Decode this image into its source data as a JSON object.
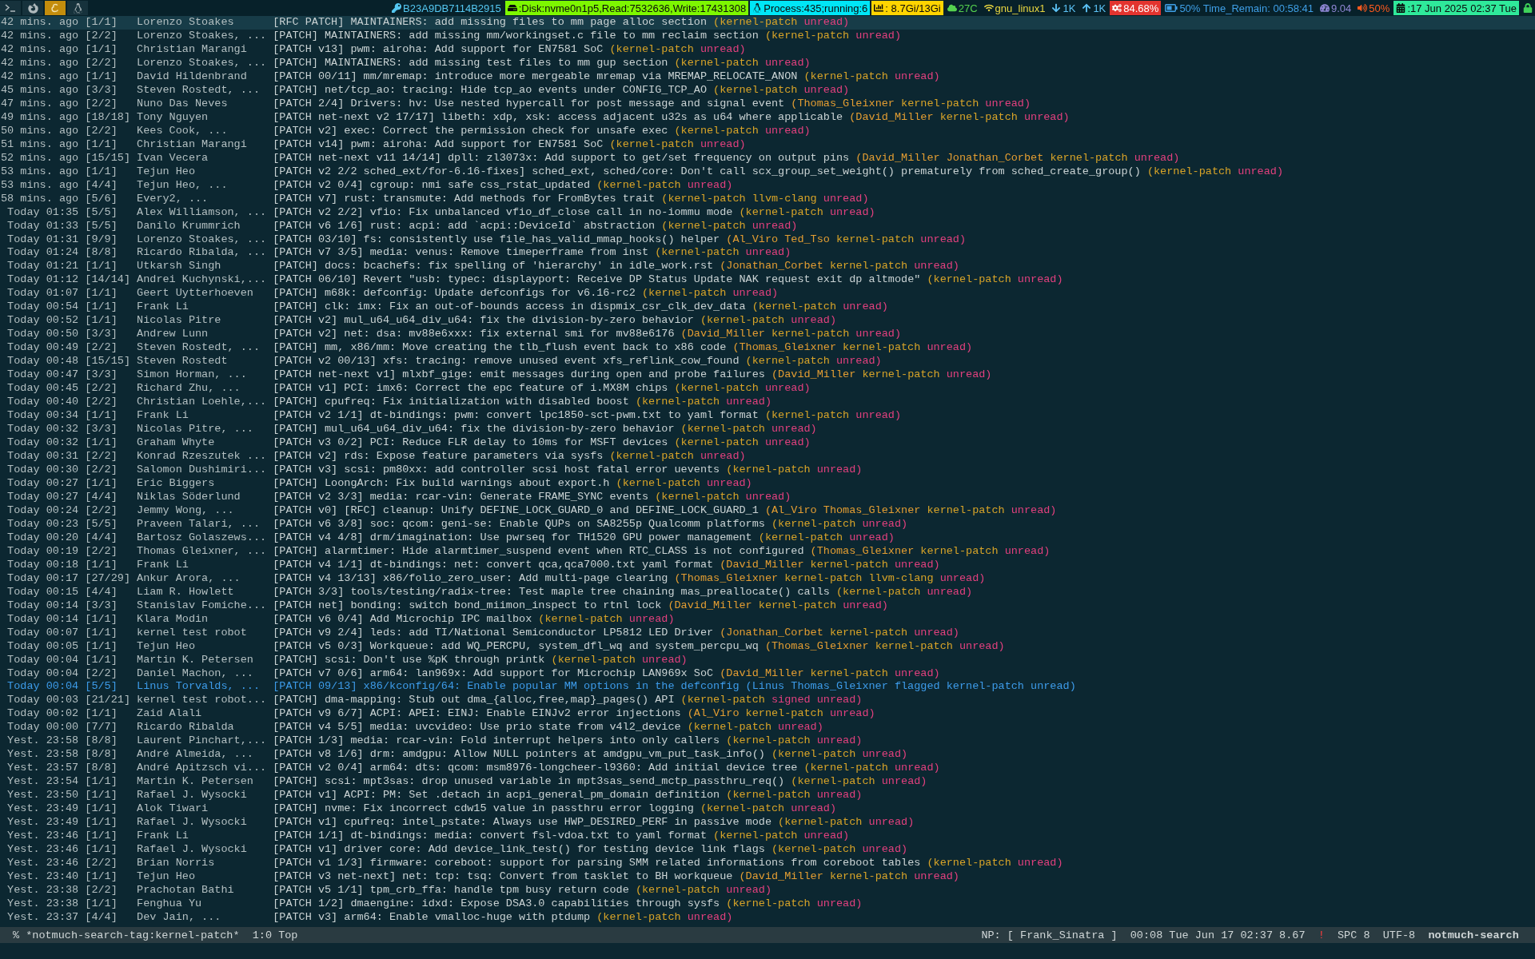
{
  "top_bar": {
    "launchers": [
      {
        "kind": "terminal",
        "selected": false
      },
      {
        "kind": "browser",
        "selected": false
      },
      {
        "kind": "editor",
        "selected": true
      },
      {
        "kind": "penguin",
        "selected": false
      }
    ],
    "segments": [
      {
        "kind": "key",
        "text": "B23A9DB7114B2915"
      },
      {
        "kind": "disk",
        "text": ":Disk:nvme0n1p5,Read:7532636,Write:17431308"
      },
      {
        "kind": "process",
        "text": "Process:435;running:6"
      },
      {
        "kind": "memory",
        "text": ": 8.7Gi/13Gi"
      },
      {
        "kind": "temperature",
        "text": "27C"
      },
      {
        "kind": "wifi",
        "text": "gnu_linux1"
      },
      {
        "kind": "down",
        "text": "1K"
      },
      {
        "kind": "up",
        "text": "1K"
      },
      {
        "kind": "cpu",
        "text": "84.68%"
      },
      {
        "kind": "battery",
        "text": "50% Time_Remain: 00:58:41"
      },
      {
        "kind": "load",
        "text": "9.04"
      },
      {
        "kind": "volume",
        "text": "50%"
      },
      {
        "kind": "clock",
        "text": ":17 Jun 2025 02:37 Tue"
      },
      {
        "kind": "lock"
      }
    ]
  },
  "threads": [
    {
      "date": "42 mins. ago",
      "count": "[1/1]",
      "authors": "Lorenzo Stoakes",
      "subject": "[RFC PATCH] MAINTAINERS: add missing files to mm page alloc section",
      "tags": [
        {
          "label": "(kernel-patch",
          "color": "#d8a428"
        },
        {
          "label": "unread)",
          "color": "#e2407e"
        }
      ],
      "selected": true,
      "flagged": false
    },
    {
      "date": "42 mins. ago",
      "count": "[2/2]",
      "authors": "Lorenzo Stoakes, ...",
      "subject": "[PATCH] MAINTAINERS: add missing mm/workingset.c file to mm reclaim section",
      "tags": [
        {
          "label": "(kernel-patch",
          "color": "#d8a428"
        },
        {
          "label": "unread)",
          "color": "#e2407e"
        }
      ],
      "selected": false,
      "flagged": false
    },
    {
      "date": "42 mins. ago",
      "count": "[1/1]",
      "authors": "Christian Marangi",
      "subject": "[PATCH v13] pwm: airoha: Add support for EN7581 SoC",
      "tags": [
        {
          "label": "(kernel-patch",
          "color": "#d8a428"
        },
        {
          "label": "unread)",
          "color": "#e2407e"
        }
      ],
      "selected": false,
      "flagged": false
    },
    {
      "date": "42 mins. ago",
      "count": "[2/2]",
      "authors": "Lorenzo Stoakes, ...",
      "subject": "[PATCH] MAINTAINERS: add missing test files to mm gup section",
      "tags": [
        {
          "label": "(kernel-patch",
          "color": "#d8a428"
        },
        {
          "label": "unread)",
          "color": "#e2407e"
        }
      ],
      "selected": false,
      "flagged": false
    },
    {
      "date": "42 mins. ago",
      "count": "[1/1]",
      "authors": "David Hildenbrand",
      "subject": "[PATCH 00/11] mm/mremap: introduce more mergeable mremap via MREMAP_RELOCATE_ANON",
      "tags": [
        {
          "label": "(kernel-patch",
          "color": "#d8a428"
        },
        {
          "label": "unread)",
          "color": "#e2407e"
        }
      ],
      "selected": false,
      "flagged": false
    },
    {
      "date": "45 mins. ago",
      "count": "[3/3]",
      "authors": "Steven Rostedt, ...",
      "subject": "[PATCH] net/tcp_ao: tracing: Hide tcp_ao events under CONFIG_TCP_AO",
      "tags": [
        {
          "label": "(kernel-patch",
          "color": "#d8a428"
        },
        {
          "label": "unread)",
          "color": "#e2407e"
        }
      ],
      "selected": false,
      "flagged": false
    },
    {
      "date": "47 mins. ago",
      "count": "[2/2]",
      "authors": "Nuno Das Neves",
      "subject": "[PATCH 2/4] Drivers: hv: Use nested hypercall for post message and signal event",
      "tags": [
        {
          "label": "(Thomas_Gleixner",
          "color": "#e39d32"
        },
        {
          "label": "kernel-patch",
          "color": "#d8a428"
        },
        {
          "label": "unread)",
          "color": "#e2407e"
        }
      ],
      "selected": false,
      "flagged": false
    },
    {
      "date": "49 mins. ago",
      "count": "[18/18]",
      "authors": "Tony Nguyen",
      "subject": "[PATCH net-next v2 17/17] libeth: xdp, xsk: access adjacent u32s as u64 where applicable",
      "tags": [
        {
          "label": "(David_Miller",
          "color": "#e39d32"
        },
        {
          "label": "kernel-patch",
          "color": "#d8a428"
        },
        {
          "label": "unread)",
          "color": "#e2407e"
        }
      ],
      "selected": false,
      "flagged": false
    },
    {
      "date": "50 mins. ago",
      "count": "[2/2]",
      "authors": "Kees Cook, ...",
      "subject": "[PATCH v2] exec: Correct the permission check for unsafe exec",
      "tags": [
        {
          "label": "(kernel-patch",
          "color": "#d8a428"
        },
        {
          "label": "unread)",
          "color": "#e2407e"
        }
      ],
      "selected": false,
      "flagged": false
    },
    {
      "date": "51 mins. ago",
      "count": "[1/1]",
      "authors": "Christian Marangi",
      "subject": "[PATCH v14] pwm: airoha: Add support for EN7581 SoC",
      "tags": [
        {
          "label": "(kernel-patch",
          "color": "#d8a428"
        },
        {
          "label": "unread)",
          "color": "#e2407e"
        }
      ],
      "selected": false,
      "flagged": false
    },
    {
      "date": "52 mins. ago",
      "count": "[15/15]",
      "authors": "Ivan Vecera",
      "subject": "[PATCH net-next v11 14/14] dpll: zl3073x: Add support to get/set frequency on output pins",
      "tags": [
        {
          "label": "(David_Miller",
          "color": "#e39d32"
        },
        {
          "label": "Jonathan_Corbet",
          "color": "#e39d32"
        },
        {
          "label": "kernel-patch",
          "color": "#d8a428"
        },
        {
          "label": "unread)",
          "color": "#e2407e"
        }
      ],
      "selected": false,
      "flagged": false
    },
    {
      "date": "53 mins. ago",
      "count": "[1/1]",
      "authors": "Tejun Heo",
      "subject": "[PATCH v2 2/2 sched_ext/for-6.16-fixes] sched_ext, sched/core: Don't call scx_group_set_weight() prematurely from sched_create_group()",
      "tags": [
        {
          "label": "(kernel-patch",
          "color": "#d8a428"
        },
        {
          "label": "unread)",
          "color": "#e2407e"
        }
      ],
      "selected": false,
      "flagged": false
    },
    {
      "date": "53 mins. ago",
      "count": "[4/4]",
      "authors": "Tejun Heo, ...",
      "subject": "[PATCH v2 0/4] cgroup: nmi safe css_rstat_updated",
      "tags": [
        {
          "label": "(kernel-patch",
          "color": "#d8a428"
        },
        {
          "label": "unread)",
          "color": "#e2407e"
        }
      ],
      "selected": false,
      "flagged": false
    },
    {
      "date": "58 mins. ago",
      "count": "[5/6]",
      "authors": "Every2, ...",
      "subject": "[PATCH v7] rust: transmute: Add methods for FromBytes trait",
      "tags": [
        {
          "label": "(kernel-patch",
          "color": "#d8a428"
        },
        {
          "label": "llvm-clang",
          "color": "#d8a428"
        },
        {
          "label": "unread)",
          "color": "#e2407e"
        }
      ],
      "selected": false,
      "flagged": false
    },
    {
      "date": "Today 01:35",
      "count": "[5/5]",
      "authors": "Alex Williamson, ...",
      "subject": "[PATCH v2 2/2] vfio: Fix unbalanced vfio_df_close call in no-iommu mode",
      "tags": [
        {
          "label": "(kernel-patch",
          "color": "#d8a428"
        },
        {
          "label": "unread)",
          "color": "#e2407e"
        }
      ],
      "selected": false,
      "flagged": false
    },
    {
      "date": "Today 01:33",
      "count": "[5/5]",
      "authors": "Danilo Krummrich",
      "subject": "[PATCH v6 1/6] rust: acpi: add `acpi::DeviceId` abstraction",
      "tags": [
        {
          "label": "(kernel-patch",
          "color": "#d8a428"
        },
        {
          "label": "unread)",
          "color": "#e2407e"
        }
      ],
      "selected": false,
      "flagged": false
    },
    {
      "date": "Today 01:31",
      "count": "[9/9]",
      "authors": "Lorenzo Stoakes, ...",
      "subject": "[PATCH 03/10] fs: consistently use file_has_valid_mmap_hooks() helper",
      "tags": [
        {
          "label": "(Al_Viro",
          "color": "#e39d32"
        },
        {
          "label": "Ted_Tso",
          "color": "#e39d32"
        },
        {
          "label": "kernel-patch",
          "color": "#d8a428"
        },
        {
          "label": "unread)",
          "color": "#e2407e"
        }
      ],
      "selected": false,
      "flagged": false
    },
    {
      "date": "Today 01:24",
      "count": "[8/8]",
      "authors": "Ricardo Ribalda, ...",
      "subject": "[PATCH v7 3/5] media: venus: Remove timeperframe from inst",
      "tags": [
        {
          "label": "(kernel-patch",
          "color": "#d8a428"
        },
        {
          "label": "unread)",
          "color": "#e2407e"
        }
      ],
      "selected": false,
      "flagged": false
    },
    {
      "date": "Today 01:21",
      "count": "[1/1]",
      "authors": "Utkarsh Singh",
      "subject": "[PATCH] docs: bcachefs: fix spelling of 'hierarchy' in idle_work.rst",
      "tags": [
        {
          "label": "(Jonathan_Corbet",
          "color": "#e39d32"
        },
        {
          "label": "kernel-patch",
          "color": "#d8a428"
        },
        {
          "label": "unread)",
          "color": "#e2407e"
        }
      ],
      "selected": false,
      "flagged": false
    },
    {
      "date": "Today 01:12",
      "count": "[14/14]",
      "authors": "Andrei Kuchynski,...",
      "subject": "[PATCH 06/10] Revert \"usb: typec: displayport: Receive DP Status Update NAK request exit dp altmode\"",
      "tags": [
        {
          "label": "(kernel-patch",
          "color": "#d8a428"
        },
        {
          "label": "unread)",
          "color": "#e2407e"
        }
      ],
      "selected": false,
      "flagged": false
    },
    {
      "date": "Today 01:07",
      "count": "[1/1]",
      "authors": "Geert Uytterhoeven",
      "subject": "[PATCH] m68k: defconfig: Update defconfigs for v6.16-rc2",
      "tags": [
        {
          "label": "(kernel-patch",
          "color": "#d8a428"
        },
        {
          "label": "unread)",
          "color": "#e2407e"
        }
      ],
      "selected": false,
      "flagged": false
    },
    {
      "date": "Today 00:54",
      "count": "[1/1]",
      "authors": "Frank Li",
      "subject": "[PATCH] clk: imx: Fix an out-of-bounds access in dispmix_csr_clk_dev_data",
      "tags": [
        {
          "label": "(kernel-patch",
          "color": "#d8a428"
        },
        {
          "label": "unread)",
          "color": "#e2407e"
        }
      ],
      "selected": false,
      "flagged": false
    },
    {
      "date": "Today 00:52",
      "count": "[1/1]",
      "authors": "Nicolas Pitre",
      "subject": "[PATCH v2] mul_u64_u64_div_u64: fix the division-by-zero behavior",
      "tags": [
        {
          "label": "(kernel-patch",
          "color": "#d8a428"
        },
        {
          "label": "unread)",
          "color": "#e2407e"
        }
      ],
      "selected": false,
      "flagged": false
    },
    {
      "date": "Today 00:50",
      "count": "[3/3]",
      "authors": "Andrew Lunn",
      "subject": "[PATCH v2] net: dsa: mv88e6xxx: fix external smi for mv88e6176",
      "tags": [
        {
          "label": "(David_Miller",
          "color": "#e39d32"
        },
        {
          "label": "kernel-patch",
          "color": "#d8a428"
        },
        {
          "label": "unread)",
          "color": "#e2407e"
        }
      ],
      "selected": false,
      "flagged": false
    },
    {
      "date": "Today 00:49",
      "count": "[2/2]",
      "authors": "Steven Rostedt, ...",
      "subject": "[PATCH] mm, x86/mm: Move creating the tlb_flush event back to x86 code",
      "tags": [
        {
          "label": "(Thomas_Gleixner",
          "color": "#e39d32"
        },
        {
          "label": "kernel-patch",
          "color": "#d8a428"
        },
        {
          "label": "unread)",
          "color": "#e2407e"
        }
      ],
      "selected": false,
      "flagged": false
    },
    {
      "date": "Today 00:48",
      "count": "[15/15]",
      "authors": "Steven Rostedt",
      "subject": "[PATCH v2 00/13] xfs: tracing: remove unused event xfs_reflink_cow_found",
      "tags": [
        {
          "label": "(kernel-patch",
          "color": "#d8a428"
        },
        {
          "label": "unread)",
          "color": "#e2407e"
        }
      ],
      "selected": false,
      "flagged": false
    },
    {
      "date": "Today 00:47",
      "count": "[3/3]",
      "authors": "Simon Horman, ...",
      "subject": "[PATCH net-next v1] mlxbf_gige: emit messages during open and probe failures",
      "tags": [
        {
          "label": "(David_Miller",
          "color": "#e39d32"
        },
        {
          "label": "kernel-patch",
          "color": "#d8a428"
        },
        {
          "label": "unread)",
          "color": "#e2407e"
        }
      ],
      "selected": false,
      "flagged": false
    },
    {
      "date": "Today 00:45",
      "count": "[2/2]",
      "authors": "Richard Zhu, ...",
      "subject": "[PATCH v1] PCI: imx6: Correct the epc feature of i.MX8M chips",
      "tags": [
        {
          "label": "(kernel-patch",
          "color": "#d8a428"
        },
        {
          "label": "unread)",
          "color": "#e2407e"
        }
      ],
      "selected": false,
      "flagged": false
    },
    {
      "date": "Today 00:40",
      "count": "[2/2]",
      "authors": "Christian Loehle,...",
      "subject": "[PATCH] cpufreq: Fix initialization with disabled boost",
      "tags": [
        {
          "label": "(kernel-patch",
          "color": "#d8a428"
        },
        {
          "label": "unread)",
          "color": "#e2407e"
        }
      ],
      "selected": false,
      "flagged": false
    },
    {
      "date": "Today 00:34",
      "count": "[1/1]",
      "authors": "Frank Li",
      "subject": "[PATCH v2 1/1] dt-bindings: pwm: convert lpc1850-sct-pwm.txt to yaml format",
      "tags": [
        {
          "label": "(kernel-patch",
          "color": "#d8a428"
        },
        {
          "label": "unread)",
          "color": "#e2407e"
        }
      ],
      "selected": false,
      "flagged": false
    },
    {
      "date": "Today 00:32",
      "count": "[3/3]",
      "authors": "Nicolas Pitre, ...",
      "subject": "[PATCH] mul_u64_u64_div_u64: fix the division-by-zero behavior",
      "tags": [
        {
          "label": "(kernel-patch",
          "color": "#d8a428"
        },
        {
          "label": "unread)",
          "color": "#e2407e"
        }
      ],
      "selected": false,
      "flagged": false
    },
    {
      "date": "Today 00:32",
      "count": "[1/1]",
      "authors": "Graham Whyte",
      "subject": "[PATCH v3 0/2] PCI: Reduce FLR delay to 10ms for MSFT devices",
      "tags": [
        {
          "label": "(kernel-patch",
          "color": "#d8a428"
        },
        {
          "label": "unread)",
          "color": "#e2407e"
        }
      ],
      "selected": false,
      "flagged": false
    },
    {
      "date": "Today 00:31",
      "count": "[2/2]",
      "authors": "Konrad Rzeszutek ...",
      "subject": "[PATCH v2] rds: Expose feature parameters via sysfs",
      "tags": [
        {
          "label": "(kernel-patch",
          "color": "#d8a428"
        },
        {
          "label": "unread)",
          "color": "#e2407e"
        }
      ],
      "selected": false,
      "flagged": false
    },
    {
      "date": "Today 00:30",
      "count": "[2/2]",
      "authors": "Salomon Dushimiri...",
      "subject": "[PATCH v3] scsi: pm80xx: add controller scsi host fatal error uevents",
      "tags": [
        {
          "label": "(kernel-patch",
          "color": "#d8a428"
        },
        {
          "label": "unread)",
          "color": "#e2407e"
        }
      ],
      "selected": false,
      "flagged": false
    },
    {
      "date": "Today 00:27",
      "count": "[1/1]",
      "authors": "Eric Biggers",
      "subject": "[PATCH] LoongArch: Fix build warnings about export.h",
      "tags": [
        {
          "label": "(kernel-patch",
          "color": "#d8a428"
        },
        {
          "label": "unread)",
          "color": "#e2407e"
        }
      ],
      "selected": false,
      "flagged": false
    },
    {
      "date": "Today 00:27",
      "count": "[4/4]",
      "authors": "Niklas Söderlund",
      "subject": "[PATCH v2 3/3] media: rcar-vin: Generate FRAME_SYNC events",
      "tags": [
        {
          "label": "(kernel-patch",
          "color": "#d8a428"
        },
        {
          "label": "unread)",
          "color": "#e2407e"
        }
      ],
      "selected": false,
      "flagged": false
    },
    {
      "date": "Today 00:24",
      "count": "[2/2]",
      "authors": "Jemmy Wong, ...",
      "subject": "[PATCH v0] [RFC] cleanup: Unify DEFINE_LOCK_GUARD_0 and DEFINE_LOCK_GUARD_1",
      "tags": [
        {
          "label": "(Al_Viro",
          "color": "#e39d32"
        },
        {
          "label": "Thomas_Gleixner",
          "color": "#e39d32"
        },
        {
          "label": "kernel-patch",
          "color": "#d8a428"
        },
        {
          "label": "unread)",
          "color": "#e2407e"
        }
      ],
      "selected": false,
      "flagged": false
    },
    {
      "date": "Today 00:23",
      "count": "[5/5]",
      "authors": "Praveen Talari, ...",
      "subject": "[PATCH v6 3/8] soc: qcom: geni-se: Enable QUPs on SA8255p Qualcomm platforms",
      "tags": [
        {
          "label": "(kernel-patch",
          "color": "#d8a428"
        },
        {
          "label": "unread)",
          "color": "#e2407e"
        }
      ],
      "selected": false,
      "flagged": false
    },
    {
      "date": "Today 00:20",
      "count": "[4/4]",
      "authors": "Bartosz Golaszews...",
      "subject": "[PATCH v4 4/8] drm/imagination: Use pwrseq for TH1520 GPU power management",
      "tags": [
        {
          "label": "(kernel-patch",
          "color": "#d8a428"
        },
        {
          "label": "unread)",
          "color": "#e2407e"
        }
      ],
      "selected": false,
      "flagged": false
    },
    {
      "date": "Today 00:19",
      "count": "[2/2]",
      "authors": "Thomas Gleixner, ...",
      "subject": "[PATCH] alarmtimer: Hide alarmtimer_suspend event when RTC_CLASS is not configured",
      "tags": [
        {
          "label": "(Thomas_Gleixner",
          "color": "#e39d32"
        },
        {
          "label": "kernel-patch",
          "color": "#d8a428"
        },
        {
          "label": "unread)",
          "color": "#e2407e"
        }
      ],
      "selected": false,
      "flagged": false
    },
    {
      "date": "Today 00:18",
      "count": "[1/1]",
      "authors": "Frank Li",
      "subject": "[PATCH v4 1/1] dt-bindings: net: convert qca,qca7000.txt yaml format",
      "tags": [
        {
          "label": "(David_Miller",
          "color": "#e39d32"
        },
        {
          "label": "kernel-patch",
          "color": "#d8a428"
        },
        {
          "label": "unread)",
          "color": "#e2407e"
        }
      ],
      "selected": false,
      "flagged": false
    },
    {
      "date": "Today 00:17",
      "count": "[27/29]",
      "authors": "Ankur Arora, ...",
      "subject": "[PATCH v4 13/13] x86/folio_zero_user: Add multi-page clearing",
      "tags": [
        {
          "label": "(Thomas_Gleixner",
          "color": "#e39d32"
        },
        {
          "label": "kernel-patch",
          "color": "#d8a428"
        },
        {
          "label": "llvm-clang",
          "color": "#d8a428"
        },
        {
          "label": "unread)",
          "color": "#e2407e"
        }
      ],
      "selected": false,
      "flagged": false
    },
    {
      "date": "Today 00:15",
      "count": "[4/4]",
      "authors": "Liam R. Howlett",
      "subject": "[PATCH 3/3] tools/testing/radix-tree: Test maple tree chaining mas_preallocate() calls",
      "tags": [
        {
          "label": "(kernel-patch",
          "color": "#d8a428"
        },
        {
          "label": "unread)",
          "color": "#e2407e"
        }
      ],
      "selected": false,
      "flagged": false
    },
    {
      "date": "Today 00:14",
      "count": "[3/3]",
      "authors": "Stanislav Fomiche...",
      "subject": "[PATCH net] bonding: switch bond_miimon_inspect to rtnl lock",
      "tags": [
        {
          "label": "(David_Miller",
          "color": "#e39d32"
        },
        {
          "label": "kernel-patch",
          "color": "#d8a428"
        },
        {
          "label": "unread)",
          "color": "#e2407e"
        }
      ],
      "selected": false,
      "flagged": false
    },
    {
      "date": "Today 00:14",
      "count": "[1/1]",
      "authors": "Klara Modin",
      "subject": "[PATCH v6 0/4] Add Microchip IPC mailbox",
      "tags": [
        {
          "label": "(kernel-patch",
          "color": "#d8a428"
        },
        {
          "label": "unread)",
          "color": "#e2407e"
        }
      ],
      "selected": false,
      "flagged": false
    },
    {
      "date": "Today 00:07",
      "count": "[1/1]",
      "authors": "kernel test robot",
      "subject": "[PATCH v9 2/4] leds: add TI/National Semiconductor LP5812 LED Driver",
      "tags": [
        {
          "label": "(Jonathan_Corbet",
          "color": "#e39d32"
        },
        {
          "label": "kernel-patch",
          "color": "#d8a428"
        },
        {
          "label": "unread)",
          "color": "#e2407e"
        }
      ],
      "selected": false,
      "flagged": false
    },
    {
      "date": "Today 00:05",
      "count": "[1/1]",
      "authors": "Tejun Heo",
      "subject": "[PATCH v5 0/3] Workqueue: add WQ_PERCPU, system_dfl_wq and system_percpu_wq",
      "tags": [
        {
          "label": "(Thomas_Gleixner",
          "color": "#e39d32"
        },
        {
          "label": "kernel-patch",
          "color": "#d8a428"
        },
        {
          "label": "unread)",
          "color": "#e2407e"
        }
      ],
      "selected": false,
      "flagged": false
    },
    {
      "date": "Today 00:04",
      "count": "[1/1]",
      "authors": "Martin K. Petersen",
      "subject": "[PATCH] scsi: Don't use %pK through printk",
      "tags": [
        {
          "label": "(kernel-patch",
          "color": "#d8a428"
        },
        {
          "label": "unread)",
          "color": "#e2407e"
        }
      ],
      "selected": false,
      "flagged": false
    },
    {
      "date": "Today 00:04",
      "count": "[2/2]",
      "authors": "Daniel Machon, ...",
      "subject": "[PATCH v7 0/6] arm64: lan969x: Add support for Microchip LAN969x SoC",
      "tags": [
        {
          "label": "(David_Miller",
          "color": "#e39d32"
        },
        {
          "label": "kernel-patch",
          "color": "#d8a428"
        },
        {
          "label": "unread)",
          "color": "#e2407e"
        }
      ],
      "selected": false,
      "flagged": false
    },
    {
      "date": "Today 00:04",
      "count": "[5/5]",
      "authors": "Linus Torvalds, ...",
      "subject": "[PATCH 09/13] x86/kconfig/64: Enable popular MM options in the defconfig",
      "tags": [
        {
          "label": "(Linus",
          "color": "#3d9be9"
        },
        {
          "label": "Thomas_Gleixner",
          "color": "#3d9be9"
        },
        {
          "label": "flagged",
          "color": "#3d9be9"
        },
        {
          "label": "kernel-patch",
          "color": "#3d9be9"
        },
        {
          "label": "unread)",
          "color": "#3d9be9"
        }
      ],
      "selected": false,
      "flagged": true
    },
    {
      "date": "Today 00:03",
      "count": "[21/21]",
      "authors": "kernel test robot...",
      "subject": "[PATCH] dma-mapping: Stub out dma_{alloc,free,map}_pages() API",
      "tags": [
        {
          "label": "(kernel-patch",
          "color": "#d8a428"
        },
        {
          "label": "signed",
          "color": "#e2407e"
        },
        {
          "label": "unread)",
          "color": "#e2407e"
        }
      ],
      "selected": false,
      "flagged": false
    },
    {
      "date": "Today 00:02",
      "count": "[1/1]",
      "authors": "Zaid Alali",
      "subject": "[PATCH v9 6/7] ACPI: APEI: EINJ: Enable EINJv2 error injections",
      "tags": [
        {
          "label": "(Al_Viro",
          "color": "#e39d32"
        },
        {
          "label": "kernel-patch",
          "color": "#d8a428"
        },
        {
          "label": "unread)",
          "color": "#e2407e"
        }
      ],
      "selected": false,
      "flagged": false
    },
    {
      "date": "Today 00:00",
      "count": "[7/7]",
      "authors": "Ricardo Ribalda",
      "subject": "[PATCH v4 5/5] media: uvcvideo: Use prio state from v4l2_device",
      "tags": [
        {
          "label": "(kernel-patch",
          "color": "#d8a428"
        },
        {
          "label": "unread)",
          "color": "#e2407e"
        }
      ],
      "selected": false,
      "flagged": false
    },
    {
      "date": "Yest. 23:58",
      "count": "[8/8]",
      "authors": "Laurent Pinchart,...",
      "subject": "[PATCH 1/3] media: rcar-vin: Fold interrupt helpers into only callers",
      "tags": [
        {
          "label": "(kernel-patch",
          "color": "#d8a428"
        },
        {
          "label": "unread)",
          "color": "#e2407e"
        }
      ],
      "selected": false,
      "flagged": false
    },
    {
      "date": "Yest. 23:58",
      "count": "[8/8]",
      "authors": "André Almeida, ...",
      "subject": "[PATCH v8 1/6] drm: amdgpu: Allow NULL pointers at amdgpu_vm_put_task_info()",
      "tags": [
        {
          "label": "(kernel-patch",
          "color": "#d8a428"
        },
        {
          "label": "unread)",
          "color": "#e2407e"
        }
      ],
      "selected": false,
      "flagged": false
    },
    {
      "date": "Yest. 23:57",
      "count": "[8/8]",
      "authors": "André Apitzsch vi...",
      "subject": "[PATCH v2 0/4] arm64: dts: qcom: msm8976-longcheer-l9360: Add initial device tree",
      "tags": [
        {
          "label": "(kernel-patch",
          "color": "#d8a428"
        },
        {
          "label": "unread)",
          "color": "#e2407e"
        }
      ],
      "selected": false,
      "flagged": false
    },
    {
      "date": "Yest. 23:54",
      "count": "[1/1]",
      "authors": "Martin K. Petersen",
      "subject": "[PATCH] scsi: mpt3sas: drop unused variable in mpt3sas_send_mctp_passthru_req()",
      "tags": [
        {
          "label": "(kernel-patch",
          "color": "#d8a428"
        },
        {
          "label": "unread)",
          "color": "#e2407e"
        }
      ],
      "selected": false,
      "flagged": false
    },
    {
      "date": "Yest. 23:50",
      "count": "[1/1]",
      "authors": "Rafael J. Wysocki",
      "subject": "[PATCH v1] ACPI: PM: Set .detach in acpi_general_pm_domain definition",
      "tags": [
        {
          "label": "(kernel-patch",
          "color": "#d8a428"
        },
        {
          "label": "unread)",
          "color": "#e2407e"
        }
      ],
      "selected": false,
      "flagged": false
    },
    {
      "date": "Yest. 23:49",
      "count": "[1/1]",
      "authors": "Alok Tiwari",
      "subject": "[PATCH] nvme: Fix incorrect cdw15 value in passthru error logging",
      "tags": [
        {
          "label": "(kernel-patch",
          "color": "#d8a428"
        },
        {
          "label": "unread)",
          "color": "#e2407e"
        }
      ],
      "selected": false,
      "flagged": false
    },
    {
      "date": "Yest. 23:49",
      "count": "[1/1]",
      "authors": "Rafael J. Wysocki",
      "subject": "[PATCH v1] cpufreq: intel_pstate: Always use HWP_DESIRED_PERF in passive mode",
      "tags": [
        {
          "label": "(kernel-patch",
          "color": "#d8a428"
        },
        {
          "label": "unread)",
          "color": "#e2407e"
        }
      ],
      "selected": false,
      "flagged": false
    },
    {
      "date": "Yest. 23:46",
      "count": "[1/1]",
      "authors": "Frank Li",
      "subject": "[PATCH 1/1] dt-bindings: media: convert fsl-vdoa.txt to yaml format",
      "tags": [
        {
          "label": "(kernel-patch",
          "color": "#d8a428"
        },
        {
          "label": "unread)",
          "color": "#e2407e"
        }
      ],
      "selected": false,
      "flagged": false
    },
    {
      "date": "Yest. 23:46",
      "count": "[1/1]",
      "authors": "Rafael J. Wysocki",
      "subject": "[PATCH v1] driver core: Add device_link_test() for testing device link flags",
      "tags": [
        {
          "label": "(kernel-patch",
          "color": "#d8a428"
        },
        {
          "label": "unread)",
          "color": "#e2407e"
        }
      ],
      "selected": false,
      "flagged": false
    },
    {
      "date": "Yest. 23:46",
      "count": "[2/2]",
      "authors": "Brian Norris",
      "subject": "[PATCH v1 1/3] firmware: coreboot: support for parsing SMM related informations from coreboot tables",
      "tags": [
        {
          "label": "(kernel-patch",
          "color": "#d8a428"
        },
        {
          "label": "unread)",
          "color": "#e2407e"
        }
      ],
      "selected": false,
      "flagged": false
    },
    {
      "date": "Yest. 23:40",
      "count": "[1/1]",
      "authors": "Tejun Heo",
      "subject": "[PATCH v3 net-next] net: tcp: tsq: Convert from tasklet to BH workqueue",
      "tags": [
        {
          "label": "(David_Miller",
          "color": "#e39d32"
        },
        {
          "label": "kernel-patch",
          "color": "#d8a428"
        },
        {
          "label": "unread)",
          "color": "#e2407e"
        }
      ],
      "selected": false,
      "flagged": false
    },
    {
      "date": "Yest. 23:38",
      "count": "[2/2]",
      "authors": "Prachotan Bathi",
      "subject": "[PATCH v5 1/1] tpm_crb_ffa: handle tpm busy return code",
      "tags": [
        {
          "label": "(kernel-patch",
          "color": "#d8a428"
        },
        {
          "label": "unread)",
          "color": "#e2407e"
        }
      ],
      "selected": false,
      "flagged": false
    },
    {
      "date": "Yest. 23:38",
      "count": "[1/1]",
      "authors": "Fenghua Yu",
      "subject": "[PATCH 1/2] dmaengine: idxd: Expose DSA3.0 capabilities through sysfs",
      "tags": [
        {
          "label": "(kernel-patch",
          "color": "#d8a428"
        },
        {
          "label": "unread)",
          "color": "#e2407e"
        }
      ],
      "selected": false,
      "flagged": false
    },
    {
      "date": "Yest. 23:37",
      "count": "[4/4]",
      "authors": "Dev Jain, ...",
      "subject": "[PATCH v3] arm64: Enable vmalloc-huge with ptdump",
      "tags": [
        {
          "label": "(kernel-patch",
          "color": "#d8a428"
        },
        {
          "label": "unread)",
          "color": "#e2407e"
        }
      ],
      "selected": false,
      "flagged": false
    }
  ],
  "mode_line": {
    "modified": "%",
    "buffer": "*notmuch-search-tag:kernel-patch*",
    "position": "1:0 Top",
    "now_playing": "NP: [ Frank_Sinatra ]",
    "time": "00:08 Tue Jun 17 02:37 8.67",
    "alert": "!",
    "indent": "SPC 8",
    "encoding": "UTF-8",
    "major_mode": "notmuch-search"
  }
}
